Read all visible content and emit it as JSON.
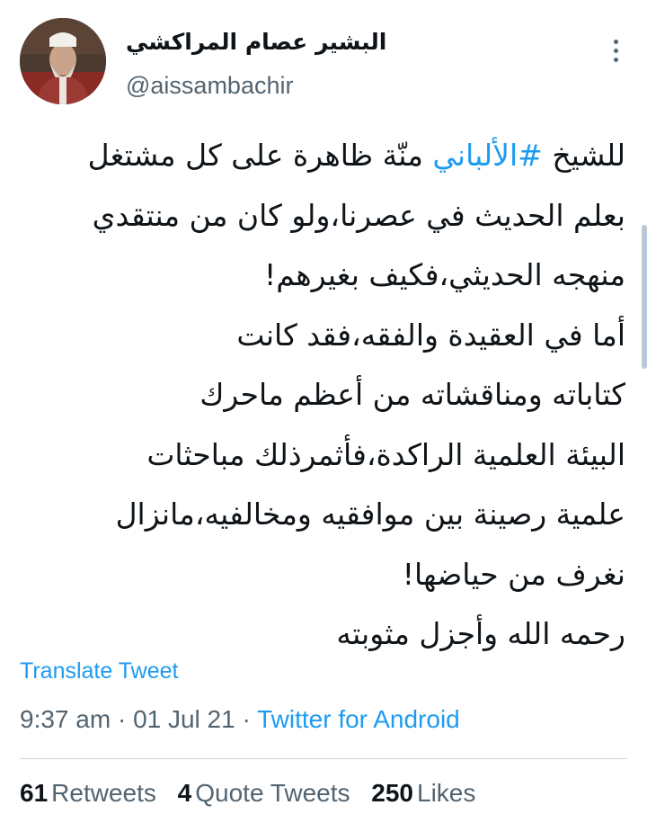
{
  "user": {
    "display_name": "البشير عصام المراكشي",
    "handle": "@aissambachir",
    "avatar_icon": "profile-photo"
  },
  "more_icon": "vertical-ellipsis-icon",
  "tweet": {
    "line1_prefix": "للشيخ ",
    "hashtag": "#الألباني",
    "line1_suffix": " منّة ظاهرة على كل مشتغل",
    "lines": [
      "بعلم الحديث في عصرنا،ولو كان من منتقدي",
      "منهجه الحديثي،فكيف بغيرهم!",
      "أما في العقيدة والفقه،فقد كانت",
      "كتاباته ومناقشاته من أعظم ماحرك",
      "البيئة العلمية الراكدة،فأثمرذلك مباحثات",
      "علمية رصينة بين موافقيه ومخالفيه،مانزال",
      "نغرف من حياضها!",
      "رحمه الله وأجزل مثوبته"
    ]
  },
  "translate_label": "Translate Tweet",
  "meta": {
    "time": "9:37 am",
    "separator1": " · ",
    "date": "01 Jul 21",
    "separator2": " · ",
    "source": "Twitter for Android"
  },
  "stats": {
    "retweets_count": "61",
    "retweets_label": "Retweets",
    "quotes_count": "4",
    "quotes_label": "Quote Tweets",
    "likes_count": "250",
    "likes_label": "Likes"
  },
  "colors": {
    "link": "#1d9bf0",
    "secondary_text": "#536471",
    "primary_text": "#0f1419"
  }
}
